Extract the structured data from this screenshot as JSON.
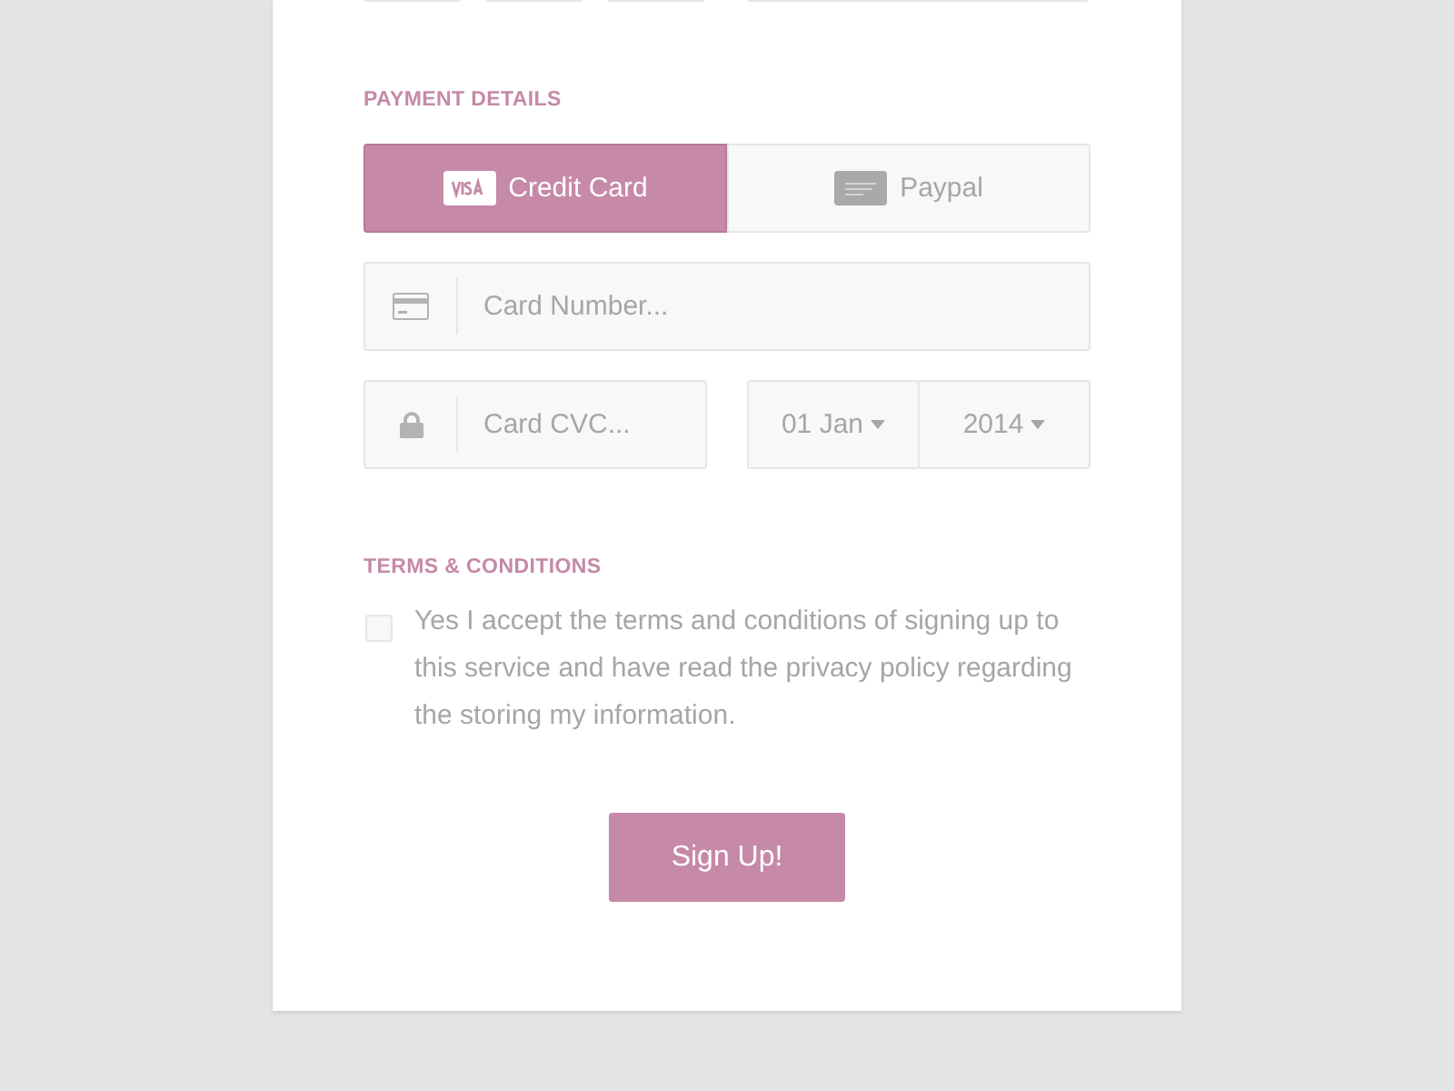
{
  "payment": {
    "heading": "PAYMENT DETAILS",
    "tabs": [
      {
        "label": "Credit Card",
        "kind": "visa",
        "selected": true
      },
      {
        "label": "Paypal",
        "kind": "paypal",
        "selected": false
      }
    ],
    "card_number": {
      "placeholder": "Card Number..."
    },
    "card_cvc": {
      "placeholder": "Card CVC..."
    },
    "expiry": [
      {
        "value": "01 Jan"
      },
      {
        "value": "2014"
      }
    ]
  },
  "terms": {
    "heading": "TERMS & CONDITIONS",
    "checked": false,
    "text": "Yes I accept the terms and conditions of signing up to this service and have read the privacy policy regarding the storing my information."
  },
  "submit": {
    "label": "Sign Up!"
  }
}
